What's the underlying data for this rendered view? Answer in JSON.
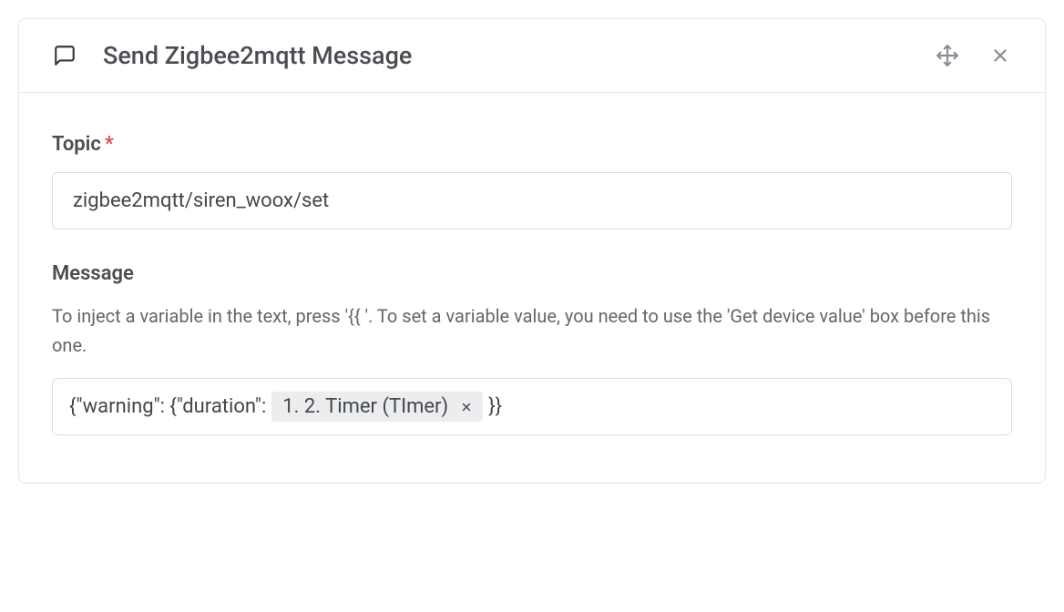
{
  "header": {
    "title": "Send Zigbee2mqtt Message"
  },
  "fields": {
    "topic": {
      "label": "Topic",
      "required_marker": "*",
      "value": "zigbee2mqtt/siren_woox/set"
    },
    "message": {
      "label": "Message",
      "help": "To inject a variable in the text, press '{{ '. To set a variable value, you need to use the 'Get device value' box before this one.",
      "prefix": "{\"warning\": {\"duration\":",
      "chip": "1. 2. Timer (TImer)",
      "suffix": "}}"
    }
  }
}
